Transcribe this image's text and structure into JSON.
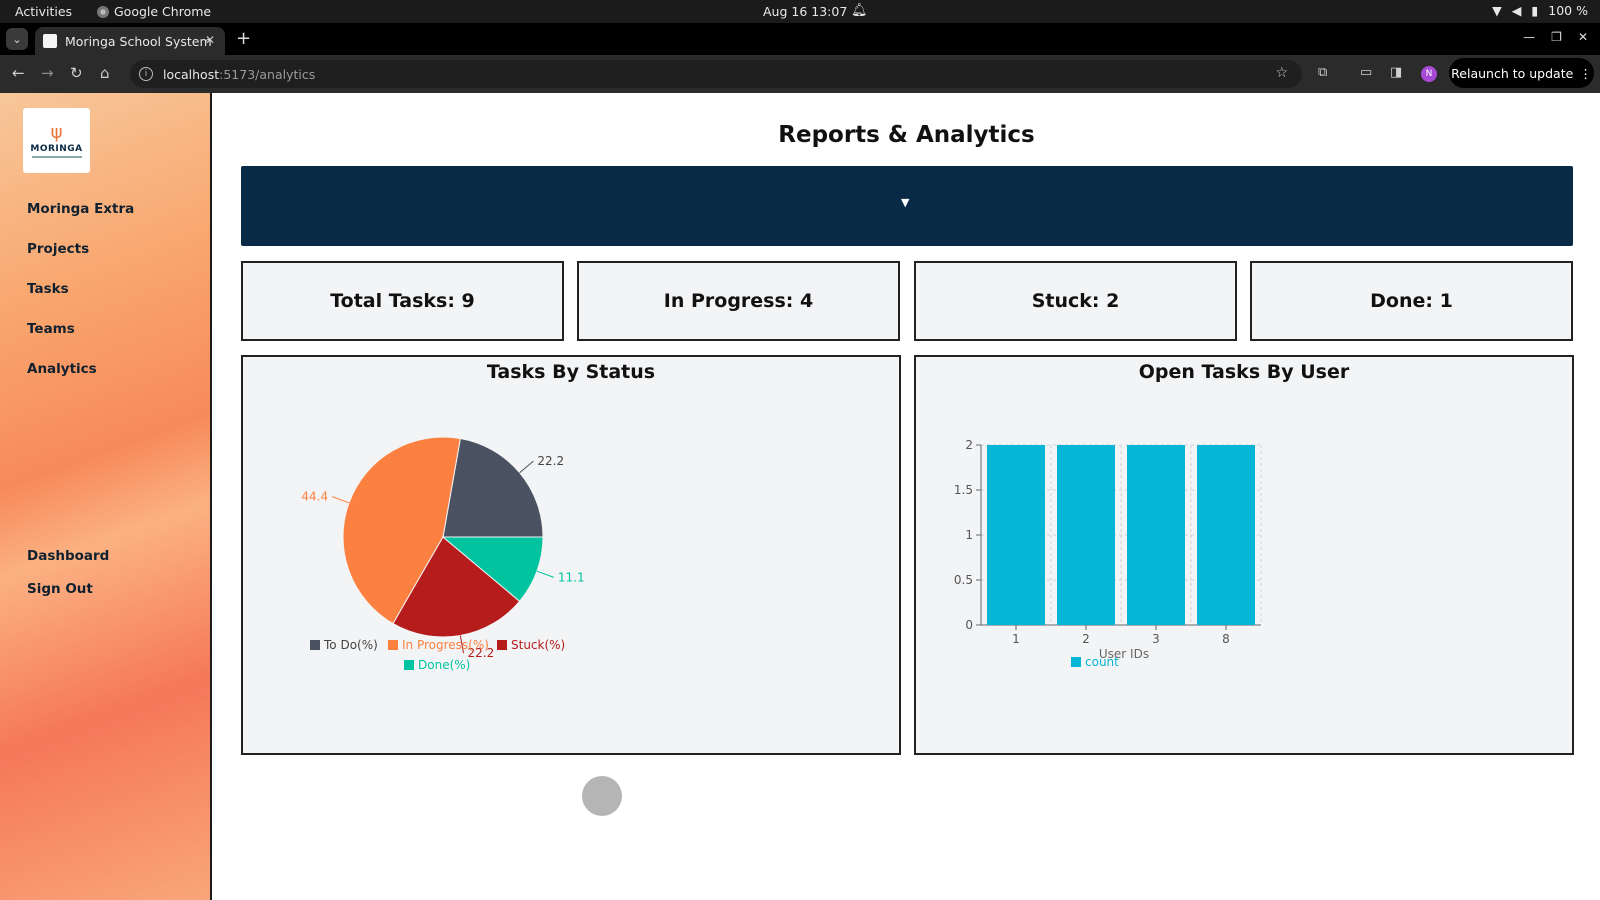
{
  "os": {
    "activities": "Activities",
    "app_name": "Google Chrome",
    "clock": "Aug 16  13:07",
    "battery": "100 %"
  },
  "browser": {
    "tab_title": "Moringa School System",
    "url_host": "localhost",
    "url_path": ":5173/analytics",
    "profile_initial": "N",
    "relaunch_label": "Relaunch to update"
  },
  "sidebar": {
    "logo_text": "MORINGA",
    "items": [
      {
        "label": "Moringa Extra"
      },
      {
        "label": "Projects"
      },
      {
        "label": "Tasks"
      },
      {
        "label": "Teams"
      },
      {
        "label": "Analytics"
      }
    ],
    "bottom_items": [
      {
        "label": "Dashboard"
      },
      {
        "label": "Sign Out"
      }
    ]
  },
  "main": {
    "title": "Reports & Analytics",
    "stats": [
      {
        "label": "Total Tasks: 9"
      },
      {
        "label": "In Progress: 4"
      },
      {
        "label": "Stuck: 2"
      },
      {
        "label": "Done: 1"
      }
    ]
  },
  "chart_data": [
    {
      "type": "pie",
      "title": "Tasks By Status",
      "slices": [
        {
          "name": "To Do(%)",
          "value": 22.2,
          "label": "22.2",
          "color": "#4a5160"
        },
        {
          "name": "In Progress(%)",
          "value": 44.4,
          "label": "44.4",
          "color": "#fc8140"
        },
        {
          "name": "Stuck(%)",
          "value": 22.2,
          "label": "22.2",
          "color": "#b71c1c"
        },
        {
          "name": "Done(%)",
          "value": 11.1,
          "label": "11.1",
          "color": "#00c49f"
        }
      ],
      "legend": "bottom"
    },
    {
      "type": "bar",
      "title": "Open Tasks By User",
      "categories": [
        "1",
        "2",
        "3",
        "8"
      ],
      "series": [
        {
          "name": "count",
          "values": [
            2,
            2,
            2,
            2
          ],
          "color": "#06b6d4"
        }
      ],
      "xlabel": "User IDs",
      "ylabel": "",
      "ylim": [
        0,
        2
      ],
      "yticks": [
        "0",
        "0.5",
        "1",
        "1.5",
        "2"
      ],
      "grid": true,
      "legend": "bottom"
    }
  ]
}
